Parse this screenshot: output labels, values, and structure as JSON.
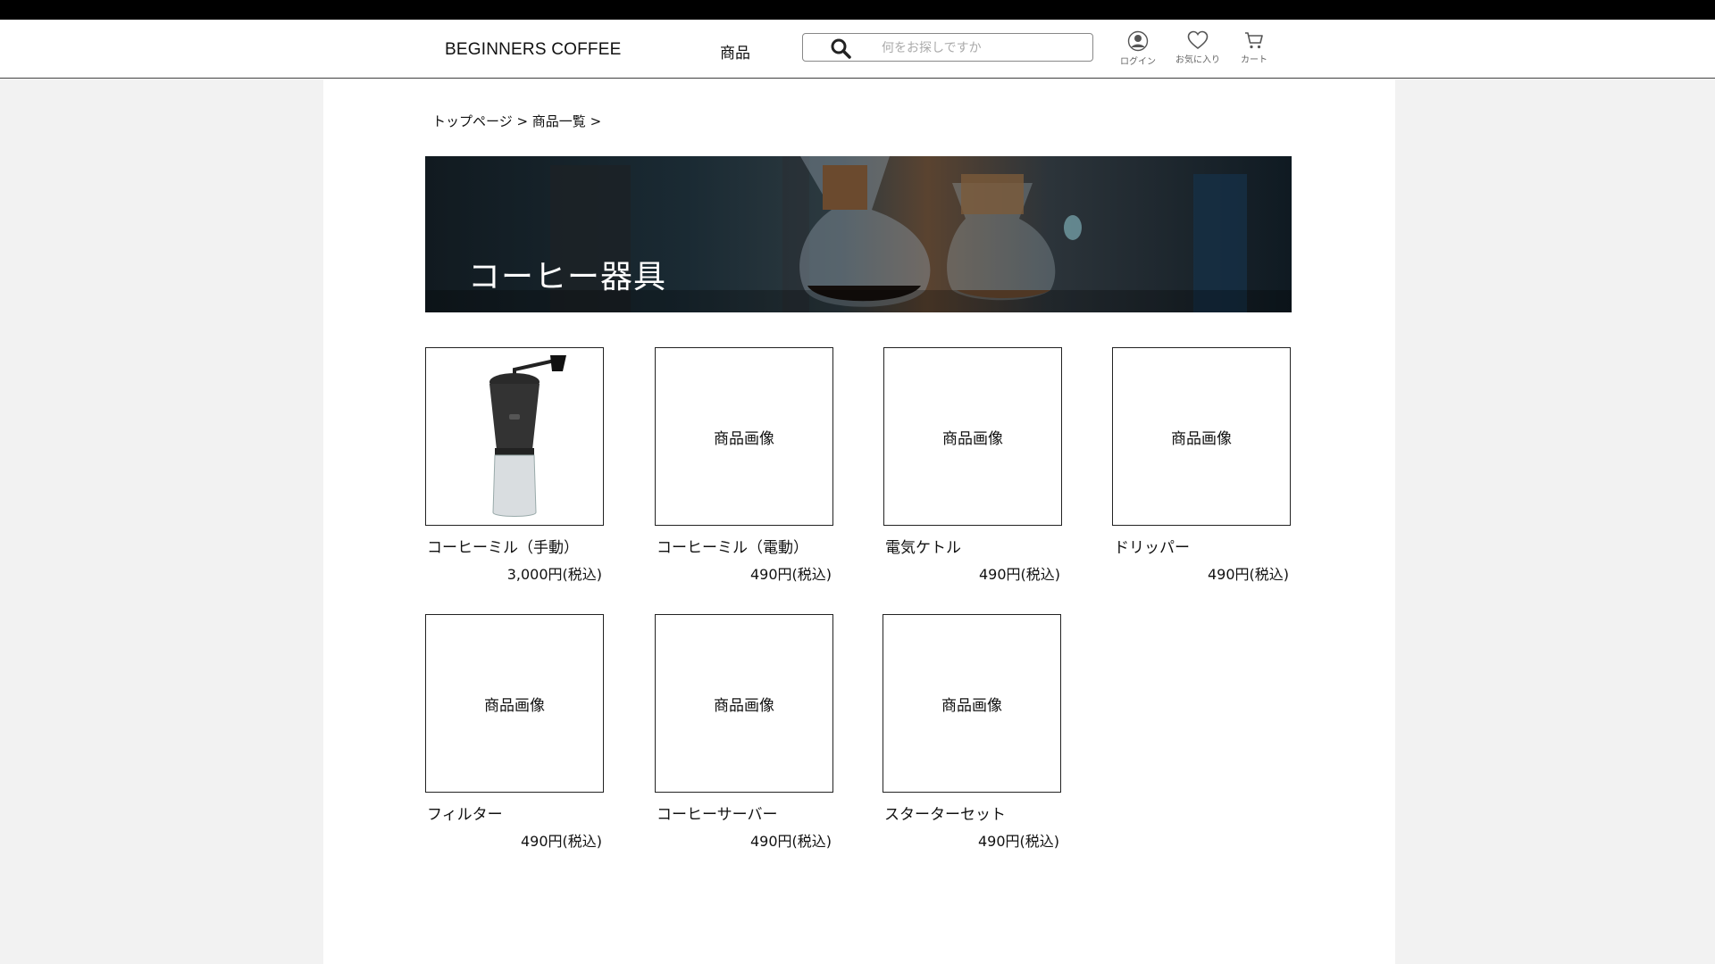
{
  "header": {
    "logo": "BEGINNERS COFFEE",
    "nav_products": "商品",
    "search_placeholder": "何をお探しですか",
    "login_label": "ログイン",
    "favorites_label": "お気に入り",
    "cart_label": "カート"
  },
  "breadcrumb": "トップページ > 商品一覧 >",
  "hero": {
    "title": "コーヒー器具"
  },
  "products": [
    {
      "name": "コーヒーミル（手動）",
      "price": "3,000円(税込)",
      "image_label": ""
    },
    {
      "name": "コーヒーミル（電動）",
      "price": "490円(税込)",
      "image_label": "商品画像"
    },
    {
      "name": "電気ケトル",
      "price": "490円(税込)",
      "image_label": "商品画像"
    },
    {
      "name": "ドリッパー",
      "price": "490円(税込)",
      "image_label": "商品画像"
    },
    {
      "name": "フィルター",
      "price": "490円(税込)",
      "image_label": "商品画像"
    },
    {
      "name": "コーヒーサーバー",
      "price": "490円(税込)",
      "image_label": "商品画像"
    },
    {
      "name": "スターターセット",
      "price": "490円(税込)",
      "image_label": "商品画像"
    }
  ]
}
